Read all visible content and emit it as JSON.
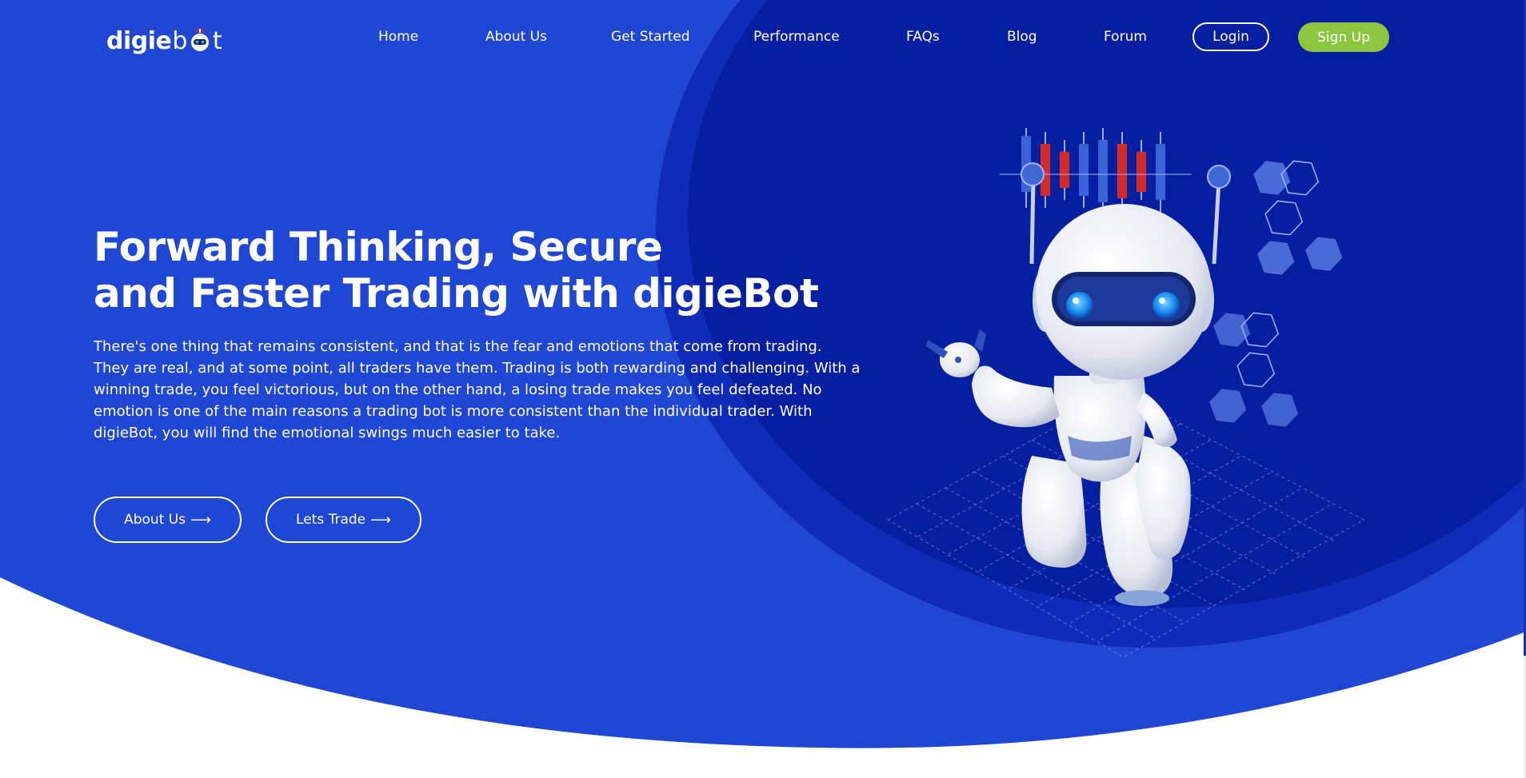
{
  "brand": {
    "logo_prefix": "digie",
    "logo_b": "b",
    "logo_t": "t"
  },
  "nav": {
    "items": [
      "Home",
      "About Us",
      "Get Started",
      "Performance",
      "FAQs",
      "Blog",
      "Forum"
    ],
    "login": "Login",
    "signup": "Sign Up"
  },
  "hero": {
    "title_line1": "Forward Thinking, Secure",
    "title_line2": "and Faster Trading with digieBot",
    "description": "There's one thing that remains consistent, and that is the fear and emotions that come from trading. They are real, and at some point, all traders have them. Trading is both rewarding and challenging. With a winning trade, you feel victorious, but on the other hand, a losing trade makes you feel defeated. No emotion is one of the main reasons a trading bot is more consistent than the individual trader. With digieBot, you will find the emotional swings much easier to take.",
    "cta_about": "About Us",
    "cta_trade": "Lets Trade",
    "arrow": "⟶"
  },
  "colors": {
    "hero_blue": "#2046d4",
    "dark_blue": "#0a22a8",
    "signup_green": "#8cc63f",
    "candle_red": "#d52a2a",
    "candle_blue": "#3a63d8"
  },
  "icons": {
    "logo_mascot": "robot-head-icon",
    "cta_arrow": "arrow-right-icon"
  }
}
